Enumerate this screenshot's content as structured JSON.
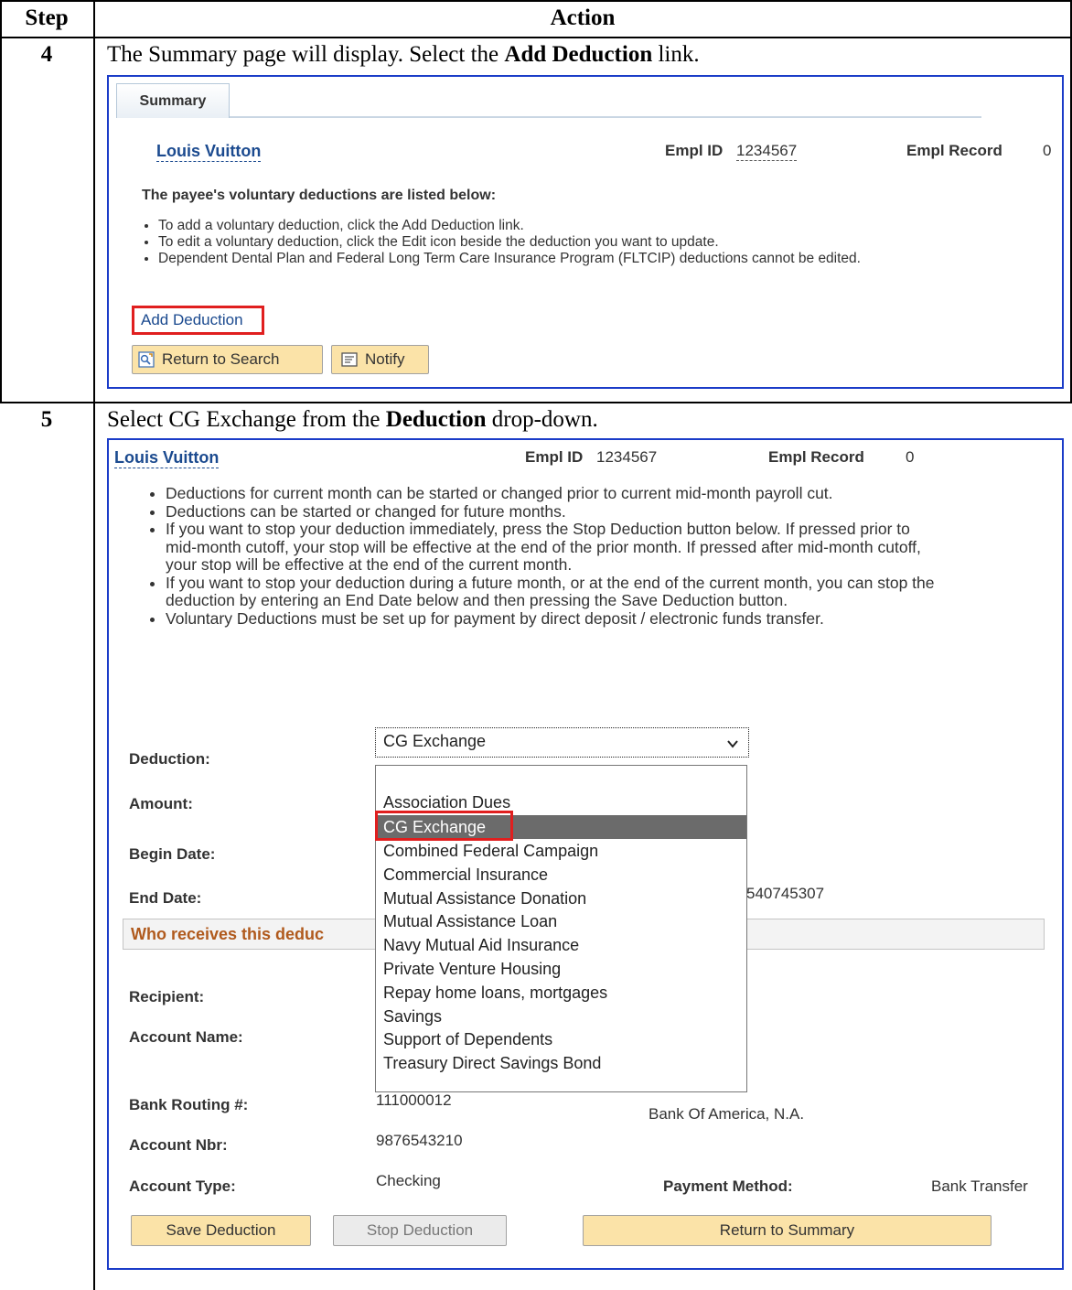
{
  "table": {
    "header_step": "Step",
    "header_action": "Action"
  },
  "step4": {
    "number": "4",
    "instruction_prefix": "The Summary page will display. Select the ",
    "instruction_bold": "Add Deduction",
    "instruction_suffix": " link.",
    "tab_label": "Summary",
    "name": "Louis Vuitton",
    "empl_id_label": "Empl ID",
    "empl_id_value": "1234567",
    "empl_record_label": "Empl Record",
    "empl_record_value": "0",
    "listed_text": "The payee's voluntary deductions are listed below:",
    "bullets": [
      "To add a voluntary deduction, click the Add Deduction link.",
      "To edit a voluntary deduction, click the Edit icon beside the deduction you want to update.",
      "Dependent Dental Plan and Federal Long Term Care Insurance Program (FLTCIP) deductions cannot be edited."
    ],
    "add_deduction_link": "Add Deduction",
    "return_to_search": "Return to Search",
    "notify": "Notify"
  },
  "step5": {
    "number": "5",
    "instruction_prefix": "Select CG Exchange from the ",
    "instruction_bold": "Deduction",
    "instruction_suffix": " drop-down.",
    "name": "Louis Vuitton",
    "empl_id_label": "Empl ID",
    "empl_id_value": "1234567",
    "empl_record_label": "Empl Record",
    "empl_record_value": "0",
    "bullets": [
      "Deductions for current month can be started or changed prior to current mid-month payroll cut.",
      "Deductions can be started or changed for future months.",
      "If you want to stop your deduction immediately, press the Stop Deduction button below. If pressed prior to mid-month cutoff, your stop will be effective at the end of the prior month. If pressed after mid-month cutoff, your stop will be effective at the end of the current month.",
      "If you want to stop your deduction during a future month, or at the end of the current month, you can stop the deduction by entering an End Date below and then pressing the Save Deduction button.",
      "Voluntary Deductions must be set up for payment by direct deposit / electronic funds transfer."
    ],
    "deduction_label": "Deduction:",
    "deduction_selected": "CG Exchange",
    "amount_label": "Amount:",
    "begin_date_label": "Begin Date:",
    "end_date_label": "End Date:",
    "end_date_partial_value": "540745307",
    "section_title": "Who receives this deduc",
    "dropdown_options": [
      "",
      "Association Dues",
      "CG Exchange",
      "Combined Federal Campaign",
      "Commercial Insurance",
      "Mutual Assistance Donation",
      "Mutual Assistance Loan",
      "Navy Mutual Aid Insurance",
      "Private Venture Housing",
      "Repay home loans, mortgages",
      "Savings",
      "Support of Dependents",
      "Treasury Direct Savings Bond"
    ],
    "dropdown_selected_index": 2,
    "recipient_label": "Recipient:",
    "account_name_label": "Account Name:",
    "bank_routing_label": "Bank Routing #:",
    "bank_routing_value": "111000012",
    "bank_name": "Bank Of America, N.A.",
    "account_nbr_label": "Account Nbr:",
    "account_nbr_value": "9876543210",
    "account_type_label": "Account Type:",
    "account_type_value": "Checking",
    "payment_method_label": "Payment Method:",
    "payment_method_value": "Bank Transfer",
    "save_deduction": "Save Deduction",
    "stop_deduction": "Stop Deduction",
    "return_to_summary": "Return to Summary"
  },
  "colors": {
    "frame_border": "#1b3cc8",
    "link_blue": "#1b4a8f",
    "button_fill": "#fbe3a8",
    "highlight_red": "#e01f1f",
    "section_title": "#b05a1d"
  }
}
